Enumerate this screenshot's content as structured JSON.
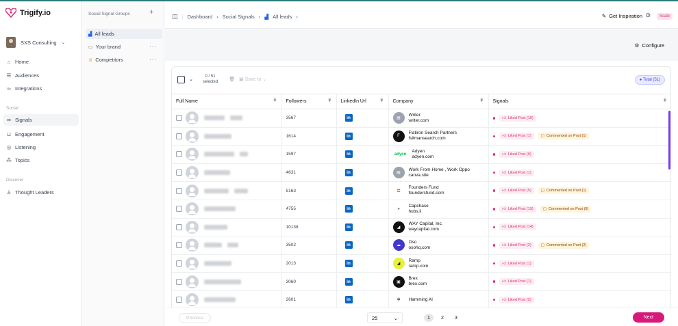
{
  "app": {
    "name": "Trigify.io"
  },
  "account": {
    "name": "SXS Consulting"
  },
  "nav": {
    "main": [
      {
        "label": "Home",
        "icon": "home-icon"
      },
      {
        "label": "Audiences",
        "icon": "list-icon"
      },
      {
        "label": "Integrations",
        "icon": "link-icon"
      }
    ],
    "social_label": "Social",
    "social": [
      {
        "label": "Signals",
        "icon": "signal-icon",
        "active": true
      },
      {
        "label": "Engagement",
        "icon": "engagement-icon"
      },
      {
        "label": "Listening",
        "icon": "listening-icon"
      },
      {
        "label": "Topics",
        "icon": "topics-icon"
      }
    ],
    "discover_label": "Discover",
    "discover": [
      {
        "label": "Thought Leaders",
        "icon": "person-icon"
      }
    ]
  },
  "groups": {
    "title": "Social Signal Groups",
    "items": [
      {
        "label": "All leads",
        "active": true
      },
      {
        "label": "Your brand"
      },
      {
        "label": "Competitors"
      }
    ]
  },
  "header": {
    "breadcrumb": [
      "Dashboard",
      "Social Signals",
      "All leads"
    ],
    "inspiration": "Get Inspiration",
    "plan_badge": "Scale"
  },
  "toolbar": {
    "configure": "Configure",
    "selected_count": "0 / 51",
    "selected_label": "selected",
    "save_to": "Save to",
    "total": "Total (51)"
  },
  "table": {
    "columns": [
      "Full Name",
      "Followers",
      "LinkedIn Url",
      "Company",
      "Signals"
    ],
    "rows": [
      {
        "followers": "3567",
        "company": "Writer",
        "domain": "writer.com",
        "logo_color": "#9ca3af",
        "logo_text": "▤",
        "signals": [
          {
            "type": "liked",
            "label": "Liked Post (10)"
          }
        ]
      },
      {
        "followers": "1614",
        "company": "Flatiron Search Partners",
        "domain": "fsilmansearch.com",
        "logo_color": "#111111",
        "logo_text": "F",
        "signals": [
          {
            "type": "liked",
            "label": "Liked Post (1)"
          },
          {
            "type": "comm",
            "label": "Commented on Post (1)"
          }
        ]
      },
      {
        "followers": "1597",
        "company": "Adyen",
        "domain": "adyen.com",
        "logo_color": "#ffffff",
        "logo_text": "adyen",
        "signals": [
          {
            "type": "liked",
            "label": "Liked Post (9)"
          }
        ]
      },
      {
        "followers": "4631",
        "company": "Work From Home , Work Oppo",
        "domain": "canva.site",
        "logo_color": "#9ca3af",
        "logo_text": "▤",
        "signals": [
          {
            "type": "liked",
            "label": "Liked Post (1)"
          }
        ]
      },
      {
        "followers": "5163",
        "company": "Founders Fund",
        "domain": "foundersfund.com",
        "logo_color": "#ffffff",
        "logo_text": "≡",
        "signals": [
          {
            "type": "liked",
            "label": "Liked Post (5)"
          },
          {
            "type": "comm",
            "label": "Commented on Post (1)"
          }
        ]
      },
      {
        "followers": "4755",
        "company": "Capchase",
        "domain": "hubs.li",
        "logo_color": "#ffffff",
        "logo_text": "»",
        "signals": [
          {
            "type": "liked",
            "label": "Liked Post (19)"
          },
          {
            "type": "comm",
            "label": "Commented on Post (8)"
          }
        ]
      },
      {
        "followers": "10138",
        "company": "WAY Capital, Inc.",
        "domain": "waycapital.com",
        "logo_color": "#111111",
        "logo_text": "◢",
        "signals": [
          {
            "type": "liked",
            "label": "Liked Post (14)"
          }
        ]
      },
      {
        "followers": "3502",
        "company": "Oso",
        "domain": "osohq.com",
        "logo_color": "#4338ca",
        "logo_text": "☁",
        "signals": [
          {
            "type": "liked",
            "label": "Liked Post (2)"
          },
          {
            "type": "comm",
            "label": "Commented on Post (2)"
          }
        ]
      },
      {
        "followers": "2013",
        "company": "Ramp",
        "domain": "ramp.com",
        "logo_color": "#e5f23a",
        "logo_text": "◢",
        "signals": [
          {
            "type": "liked",
            "label": "Liked Post (1)"
          }
        ]
      },
      {
        "followers": "3060",
        "company": "Brex",
        "domain": "brex.com",
        "logo_color": "#111111",
        "logo_text": "▣",
        "signals": [
          {
            "type": "liked",
            "label": "Liked Post (1)"
          }
        ]
      },
      {
        "followers": "2601",
        "company": "Hamming AI",
        "domain": "",
        "logo_color": "#ffffff",
        "logo_text": "✲",
        "signals": [
          {
            "type": "liked",
            "label": "Liked Post (2)"
          }
        ]
      }
    ]
  },
  "pagination": {
    "previous": "Previous",
    "per_page": "25",
    "pages": [
      "1",
      "2",
      "3"
    ],
    "current": "1",
    "next": "Next"
  },
  "colors": {
    "brand": "#e0317d",
    "next_button": "#d6197a",
    "linkedin": "#0a66c2"
  }
}
